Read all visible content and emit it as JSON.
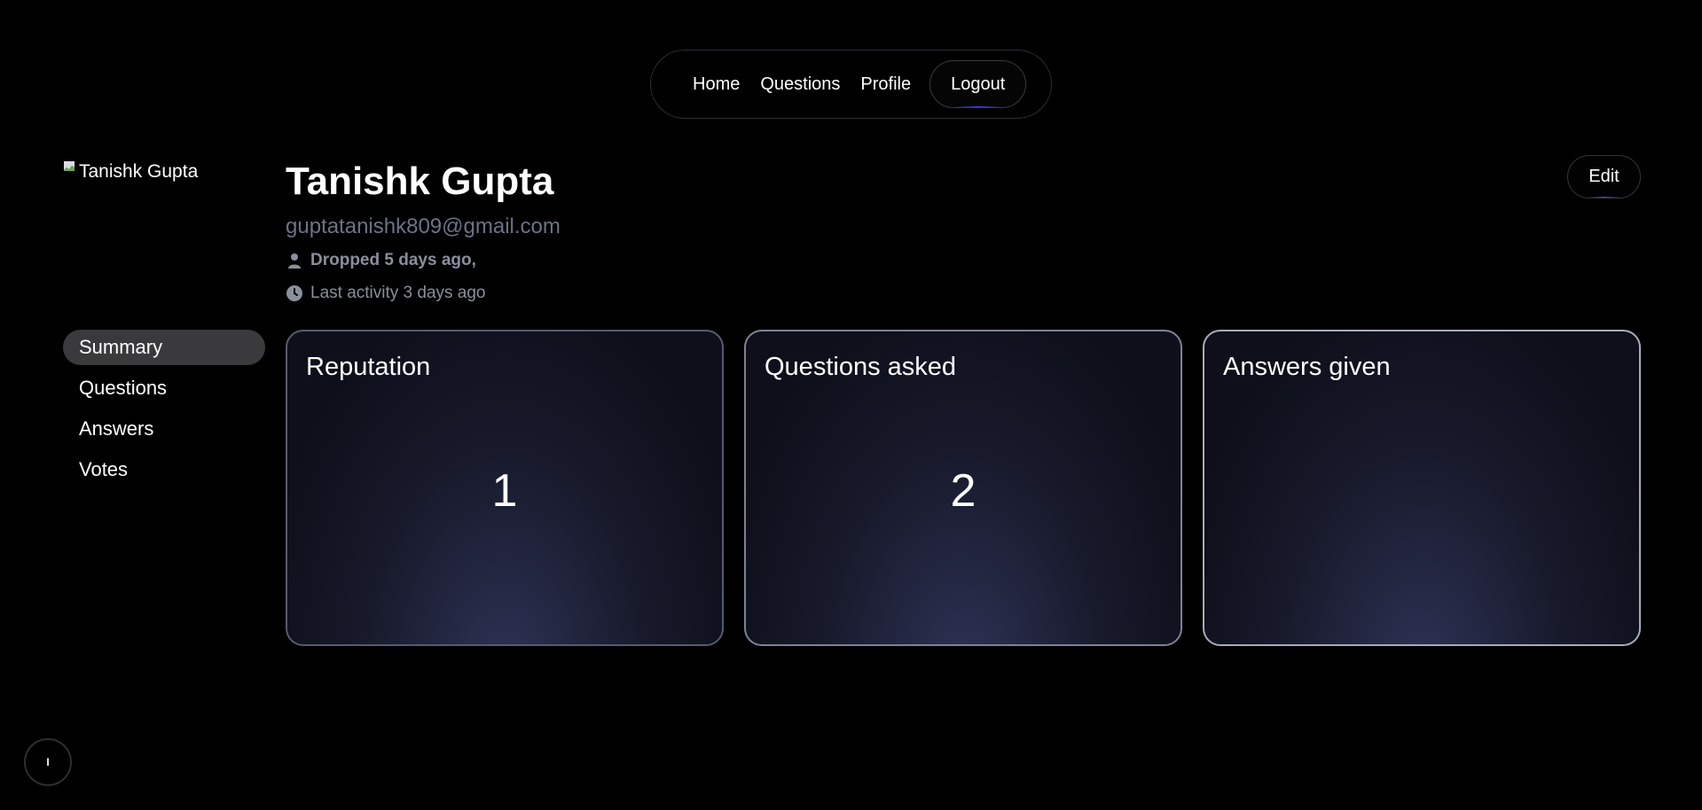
{
  "nav": {
    "items": [
      {
        "label": "Home"
      },
      {
        "label": "Questions"
      },
      {
        "label": "Profile"
      }
    ],
    "logout_label": "Logout"
  },
  "profile": {
    "avatar_alt": "Tanishk Gupta",
    "name": "Tanishk Gupta",
    "email": "guptatanishk809@gmail.com",
    "dropped_text": "Dropped 5 days ago,",
    "activity_text": "Last activity 3 days ago",
    "edit_label": "Edit"
  },
  "sidebar": {
    "items": [
      {
        "label": "Summary",
        "active": true
      },
      {
        "label": "Questions",
        "active": false
      },
      {
        "label": "Answers",
        "active": false
      },
      {
        "label": "Votes",
        "active": false
      }
    ]
  },
  "stats": [
    {
      "title": "Reputation",
      "value": "1"
    },
    {
      "title": "Questions asked",
      "value": "2"
    },
    {
      "title": "Answers given",
      "value": ""
    }
  ],
  "floating_button": {
    "label": "I"
  },
  "icons": {
    "dropped": "user-icon",
    "activity": "clock-icon",
    "avatar": "broken-image-icon"
  },
  "colors": {
    "background": "#000000",
    "muted_text": "#6c7386",
    "accent_underline": "#4b4bff",
    "active_sidebar": "#3a3a3c"
  }
}
